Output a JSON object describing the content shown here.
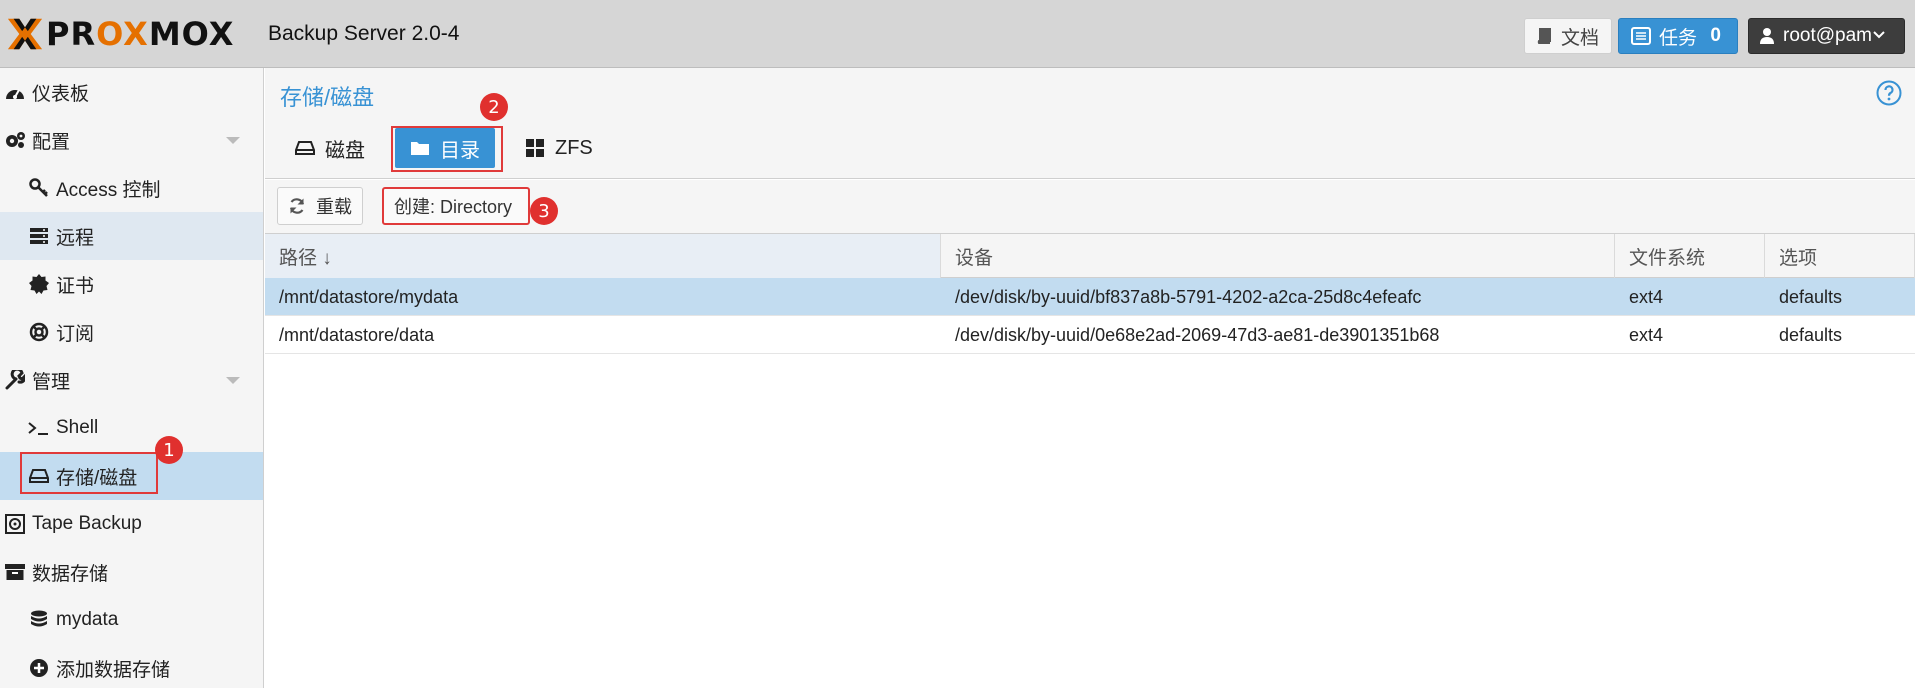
{
  "header": {
    "logo_text": "PROXMOX",
    "product": "Backup Server 2.0-4",
    "docs_label": "文档",
    "tasks_label": "任务",
    "tasks_count": "0",
    "user_label": "root@pam"
  },
  "sidebar": {
    "items": [
      {
        "label": "仪表板",
        "icon": "dashboard-icon"
      },
      {
        "label": "配置",
        "icon": "gears-icon"
      },
      {
        "label": "Access 控制",
        "icon": "key-icon"
      },
      {
        "label": "远程",
        "icon": "server-icon"
      },
      {
        "label": "证书",
        "icon": "certificate-icon"
      },
      {
        "label": "订阅",
        "icon": "support-icon"
      },
      {
        "label": "管理",
        "icon": "wrench-icon"
      },
      {
        "label": "Shell",
        "icon": "terminal-icon"
      },
      {
        "label": "存储/磁盘",
        "icon": "hdd-icon"
      },
      {
        "label": "Tape Backup",
        "icon": "tape-icon"
      },
      {
        "label": "数据存储",
        "icon": "archive-icon"
      },
      {
        "label": "mydata",
        "icon": "database-icon"
      },
      {
        "label": "添加数据存储",
        "icon": "plus-circle-icon"
      }
    ]
  },
  "panel": {
    "title": "存储/磁盘",
    "tabs": [
      {
        "label": "磁盘",
        "icon": "hdd-icon"
      },
      {
        "label": "目录",
        "icon": "folder-icon",
        "active": true
      },
      {
        "label": "ZFS",
        "icon": "th-large-icon"
      }
    ]
  },
  "toolbar": {
    "reload_label": "重载",
    "create_label": "创建: Directory"
  },
  "table": {
    "columns": [
      "路径 ↓",
      "设备",
      "文件系统",
      "选项"
    ],
    "rows": [
      [
        "/mnt/datastore/mydata",
        "/dev/disk/by-uuid/bf837a8b-5791-4202-a2ca-25d8c4efeafc",
        "ext4",
        "defaults"
      ],
      [
        "/mnt/datastore/data",
        "/dev/disk/by-uuid/0e68e2ad-2069-47d3-ae81-de3901351b68",
        "ext4",
        "defaults"
      ]
    ]
  },
  "annotations": {
    "step1": "1",
    "step2": "2",
    "step3": "3"
  },
  "colors": {
    "accent": "#3892d4",
    "brand_orange": "#e57000",
    "annotation_red": "#e03a3a",
    "selection": "#c2dcf0"
  }
}
